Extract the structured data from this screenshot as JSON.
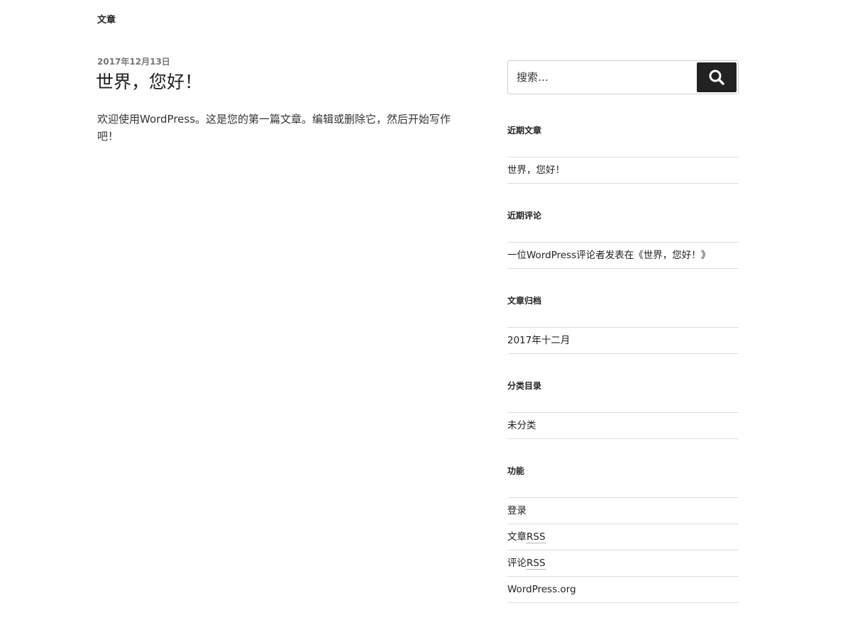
{
  "header": {
    "title": "文章"
  },
  "post": {
    "date": "2017年12月13日",
    "title": "世界，您好！",
    "body": "欢迎使用WordPress。这是您的第一篇文章。编辑或删除它，然后开始写作吧！"
  },
  "search": {
    "placeholder": "搜索…",
    "value": "",
    "icon": "search-icon"
  },
  "widgets": {
    "recent_posts": {
      "title": "近期文章",
      "items": [
        "世界，您好！"
      ]
    },
    "recent_comments": {
      "title": "近期评论",
      "items": [
        "一位WordPress评论者发表在《世界，您好！》"
      ]
    },
    "archives": {
      "title": "文章归档",
      "items": [
        "2017年十二月"
      ]
    },
    "categories": {
      "title": "分类目录",
      "items": [
        "未分类"
      ]
    },
    "meta": {
      "title": "功能",
      "login": "登录",
      "entries_prefix": "文章",
      "comments_prefix": "评论",
      "rss": "RSS",
      "wordpress_org": "WordPress.org"
    }
  }
}
